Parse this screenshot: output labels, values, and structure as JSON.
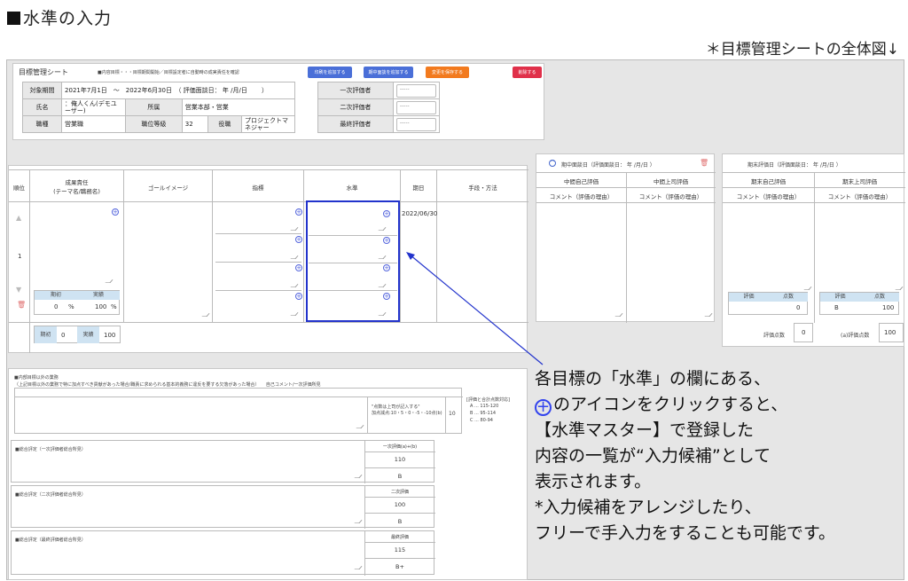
{
  "heading": "水準の入力",
  "overview_note": "＊目標管理シートの全体図↓",
  "sheet": {
    "title": "目標管理シート",
    "top_note": "■内容目標・・・目標期間開始／目標設定者に自動時の成実責任を確認",
    "buttons": [
      "印刷を追加する",
      "期中面談を追加する",
      "変更を保存する",
      "削除する"
    ],
    "button_colors": [
      "#4a6fd8",
      "#4a6fd8",
      "#f27a1e",
      "#e0304a"
    ],
    "info": {
      "period_label": "対象期間",
      "period_value": "2021年7月1日　～　2022年6月30日　（ 評価面談日： 年 /月/日　　 ）",
      "name_label": "氏名",
      "name_value": "：俺人くん(デモユーザー)",
      "dept_label": "所属",
      "dept_value": "営業本部・営業",
      "job_label": "職種",
      "job_value": "営業職",
      "grade_label": "職位等級",
      "grade_value": "32",
      "position_label": "役職",
      "position_value": "プロジェクトマネジャー"
    },
    "evaluators": [
      {
        "label": "一次評価者",
        "value": "-----"
      },
      {
        "label": "二次評価者",
        "value": "-----"
      },
      {
        "label": "最終評価者",
        "value": "-----"
      }
    ],
    "goal_headers": {
      "rank": "順位",
      "result": "成果責任\n(テーマ名/職務名)",
      "goal": "ゴールイメージ",
      "index": "指標",
      "level": "水準",
      "date": "期日",
      "method": "手段・方法"
    },
    "goal_row": {
      "rank": "1",
      "date": "2022/06/30",
      "weight_label": "期初",
      "weight_value": "0",
      "weight_unit": "%",
      "actual_label": "実績",
      "actual_value": "100",
      "actual_unit": "%"
    },
    "totals": {
      "initial_label": "期初",
      "initial_value": "0",
      "actual_label": "実績",
      "actual_value": "100"
    },
    "mid": {
      "header": "期中面談日（評価面談日： 年 /月/日 ）",
      "self_label": "中間自己評価",
      "boss_label": "中間上司評価",
      "self_comment": "コメント（評価の理由）",
      "boss_comment": "コメント（評価の理由）"
    },
    "final": {
      "header": "期末評価日（評価面談日： 年 /月/日 ）",
      "self_label": "期末自己評価",
      "boss_label": "期末上司評価",
      "self_comment": "コメント（評価の理由）",
      "boss_comment": "コメント（評価の理由）",
      "eval_label": "評価",
      "score_label": "点数",
      "self_score": "0",
      "boss_grade": "B",
      "boss_score": "100",
      "sum1_label": "評価点数",
      "sum1_value": "0",
      "sum2_label": "(a)評価点数",
      "sum2_value": "100"
    },
    "other": {
      "title": "■内部目標以外の業務",
      "sub": "（上記目標以外の業務で特に加点すべき貢献があった場合/職責に求められる基本的義務に違反を要する欠落があった場合）　　自己コメント/一次評価所見",
      "note1": "\"点数は上司が記入する\"",
      "note2": "加点減点:10・5・0・-5・-10点(b)",
      "value": "10",
      "legend_title": "[評価と合計点数対応]",
      "legend": [
        "A ... 115-120",
        "B ... 95-114",
        "C ... 80-94"
      ]
    },
    "overall": [
      {
        "label": "■総合評定（一次評価者総合所見）",
        "col_label": "一次評価(a)+(b)",
        "score": "110",
        "grade": "B"
      },
      {
        "label": "■総合評定（二次評価者総合所見）",
        "col_label": "二次評価",
        "score": "100",
        "grade": "B"
      },
      {
        "label": "■総合評定（最終評価者総合所見）",
        "col_label": "最終評価",
        "score": "115",
        "grade": "B+"
      }
    ]
  },
  "callout_lines": [
    "各目標の「水準」の欄にある、",
    "のアイコンをクリックすると、",
    "【水準マスター】で登録した",
    "内容の一覧が“入力候補”として",
    "表示されます。",
    "*入力候補をアレンジしたり、",
    "フリーで手入力をすることも可能です。"
  ],
  "colors": {
    "highlight": "#2233cc",
    "plus": "#3344ee"
  }
}
